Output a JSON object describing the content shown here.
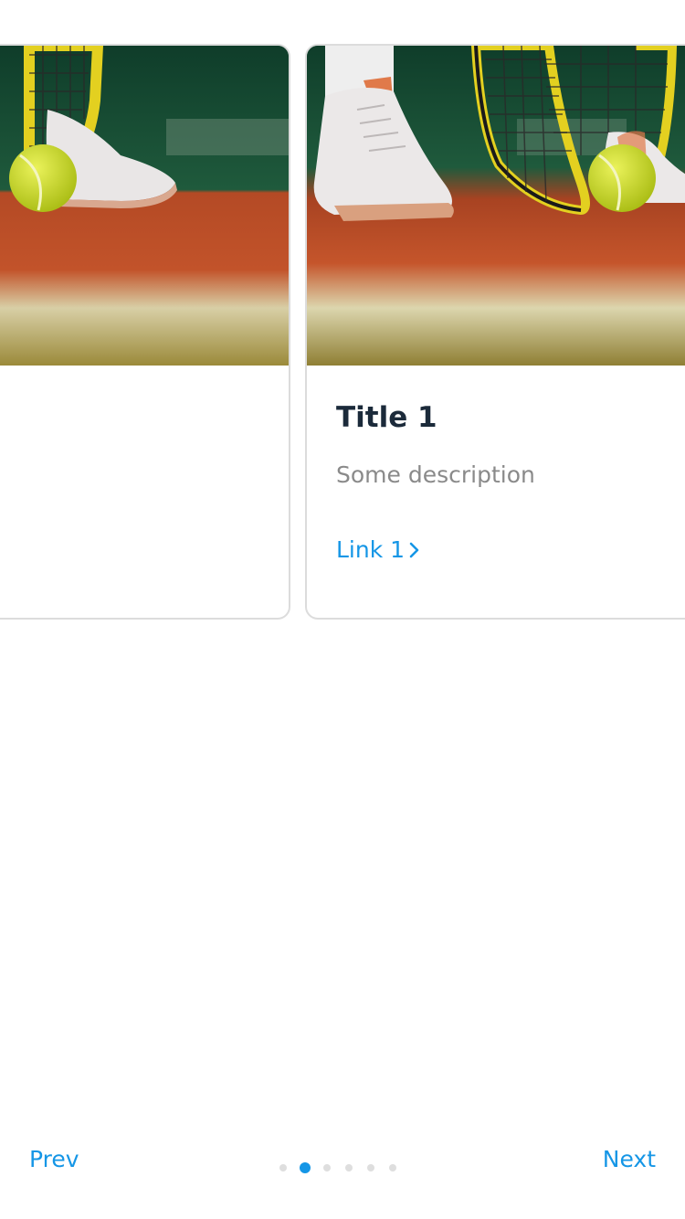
{
  "carousel": {
    "active_index": 1,
    "slide_count": 6,
    "cards": [
      {
        "image": "tennis-court-photo",
        "title": "",
        "description": "",
        "link": ""
      },
      {
        "image": "tennis-court-photo",
        "title": "Title 1",
        "description": "Some description",
        "link": "Link 1"
      }
    ]
  },
  "footer": {
    "prev_label": "Prev",
    "next_label": "Next"
  },
  "colors": {
    "accent": "#1596e6",
    "title": "#1b2a3a",
    "description": "#8a8a8a",
    "dot_inactive": "#dedede",
    "card_border": "#dcdcdc"
  }
}
